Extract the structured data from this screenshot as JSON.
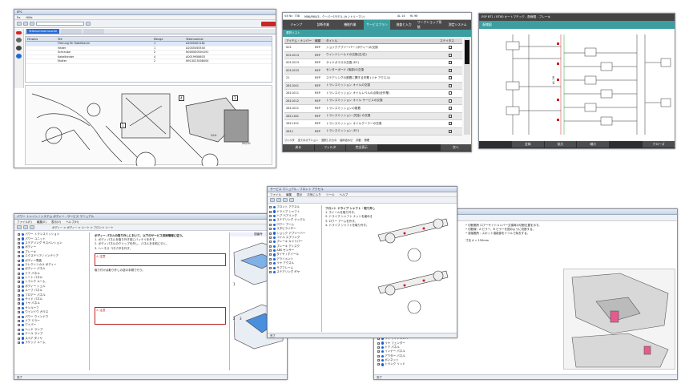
{
  "win1": {
    "title": "EPC",
    "menu": [
      "Ex.",
      "Hilfe"
    ],
    "tab_active": "Teilenummernsuche",
    "list_headers": [
      "Hinweis",
      "Teil",
      "Menge",
      "Teilenummer"
    ],
    "list_rows": [
      {
        "desc": "Führung für Kabelbaum",
        "qty": "1",
        "num": "A2045401181"
      },
      {
        "desc": "Halter",
        "qty": "1",
        "num": "A2045450540"
      },
      {
        "desc": "Schraube",
        "qty": "2",
        "num": "N000000004191"
      },
      {
        "desc": "Kabelbinder",
        "qty": "4",
        "num": "A0019958603"
      },
      {
        "desc": "Mutter",
        "qty": "2",
        "num": "N913023008004"
      }
    ],
    "callouts": [
      "1",
      "2",
      "3",
      "4"
    ],
    "diagram_labels": [
      "1",
      "4",
      "3",
      "G14",
      "X4/10"
    ]
  },
  "win2": {
    "header": {
      "left": "V4 Nr.: 738",
      "model_label": "MINI/R60/3 - クーパーSモデル (カントリーマン)",
      "ref": "AL 14",
      "ref2": "HL 98"
    },
    "tabs": [
      "ジャンプ",
      "診断作業",
      "機能作業",
      "サービスプラン",
      "検査と入力",
      "ワークショップ系統",
      "測定システム"
    ],
    "active_tab": "サービスプラン",
    "subtab": "選択リスト",
    "columns": [
      "アイテム・ナンバー",
      "種類",
      "タイトル",
      "ステイタス"
    ],
    "rows": [
      {
        "num": "001",
        "kind": "REP",
        "title": "ショックアブソーバー (ボディー)の交換"
      },
      {
        "num": "0011013",
        "kind": "REP",
        "title": "ウインドシールドの交換(左/右)"
      },
      {
        "num": "0011023",
        "kind": "REP",
        "title": "サイドガラスの交換 (EC)"
      },
      {
        "num": "0011033",
        "kind": "REP",
        "title": "センターボード (後部)の交換"
      },
      {
        "num": "21",
        "kind": "REP",
        "title": "ステアリングの脱着に関する作業 (リヤ アクスル)"
      },
      {
        "num": "2811041",
        "kind": "REP",
        "title": "トランスミッション オイルの交換"
      },
      {
        "num": "2811011",
        "kind": "REP",
        "title": "トランスミッション オイルレベルの点検(全作業)"
      },
      {
        "num": "2811012",
        "kind": "REP",
        "title": "トランスミッション オイル サービスの交換"
      },
      {
        "num": "2811021",
        "kind": "REP",
        "title": "トランスミッションの脱着"
      },
      {
        "num": "2811181",
        "kind": "REP",
        "title": "トランスミッション (完全) の交換"
      },
      {
        "num": "2811101",
        "kind": "REP",
        "title": "トランスミッション オイルクーラーの交換"
      },
      {
        "num": "2811",
        "kind": "REP",
        "title": "トランスミッション (EC)"
      }
    ],
    "footer_left": "フィルタ",
    "footer_radio": [
      "全てのオプション",
      "選択したもの",
      "組み合わせ",
      "手動",
      "修理"
    ],
    "buttons": [
      "戻る",
      "フィルタ",
      "完全表示",
      "次へ"
    ]
  },
  "win3": {
    "title": "ESP  BT1 / BT80 オートマチック - 配線図 - ブレーキ",
    "tab": "配線図",
    "left_label": "AL 16",
    "buttons": [
      "全体",
      "拡大",
      "縮小",
      "クローズ"
    ]
  },
  "win4": {
    "title": "パワー トレイン / システム ボディー - サービス マニュアル",
    "menu": [
      "ファイル(F)",
      "編集(E)",
      "表示(V)",
      "ヘルプ(H)"
    ],
    "breadcrumb": "ボディー > ボディー > シート > フロント シート",
    "tree": [
      "パワー トランスミッション",
      "パワー ユニット",
      "ステアリング サスペンション",
      "ボディー",
      "ブレーキ",
      "エクステリア / インテリア",
      "ボディー電装",
      "エレクトリカル ボディー",
      "ボディー パネル",
      "ドア パネル",
      "シート パネル",
      "トランク ルーム",
      "ボディー シェル",
      "ルーフ パネル",
      "フロアー パネル",
      "サイド パネル",
      "リヤ パネル",
      "サンルーフ",
      "ウインドウ ガラス",
      "パワー ウインドウ",
      "ドア ミラー",
      "ワイパー",
      "ヘッド ランプ",
      "テール ランプ",
      "スペア タイヤ",
      "ラゲッジ ルーム"
    ],
    "content_title": "ボディー パネルの取り外しにおいて、以下のサービス技術情報に従う。",
    "steps": [
      "1. ボディ パネルを取り外す前にバッテリを外す。",
      "2. ボディ パネルのクリップを外し、パネルを手前に引く。",
      "3. ハーネス コネクタを外す。"
    ],
    "warning_label": "注意",
    "note": "取り付けは取り外しの逆の手順で行う。",
    "statusbar": "完了",
    "figure_title": "図番号",
    "fig_nums": [
      "1",
      "2",
      "3"
    ]
  },
  "win5": {
    "title": "サービス マニュアル - フロント アクセル",
    "menu": [
      "ファイル",
      "編集",
      "表示",
      "お気に入り",
      "ツール",
      "ヘルプ"
    ],
    "tree": [
      "フロント アクスル",
      "ドライブ シャフト",
      "ハブ ベアリング",
      "ステアリング ナックル",
      "ロワー アーム",
      "スタビライザー",
      "ショック アブソーバー",
      "コイル スプリング",
      "ブレーキ キャリパー",
      "ブレーキ ディスク",
      "ABS センサー",
      "タイヤ / ホイール",
      "アライメント",
      "リヤ アクスル",
      "サブフレーム",
      "ステアリング ギヤ"
    ],
    "content_title": "フロント ドライブ シャフト - 取り外し",
    "steps": [
      "1. ホイールを取り外す。",
      "2. ドライブ シャフト ナットを緩める。",
      "3. ロワー アームを外す。",
      "4. ドライブ シャフトを取り外す。"
    ],
    "statusbar": "完了"
  },
  "win6": {
    "title": "ボディー修理マニュアル",
    "lines": [
      "• 切断箇所 ロアーサイドメンバー交換時の切断位置を示す。",
      "• 切断線 : A ピラー、B ピラーを図のように切断する。",
      "• 溶接箇所 : スポット溶接部をドリルで除去する。"
    ],
    "section": "寸法 A = 150mm",
    "tree": [
      "サイド フレーム後部",
      "ルーフ パネル",
      "フロント フロア",
      "フロント サイドメンバー",
      "リヤ フロア",
      "リヤ サイドメンバー",
      "リヤ フェンダー",
      "ドア パネル",
      "インナー パネル",
      "アウター パネル",
      "ボンネット",
      "トランク リッド"
    ],
    "statusbar": "完了"
  }
}
